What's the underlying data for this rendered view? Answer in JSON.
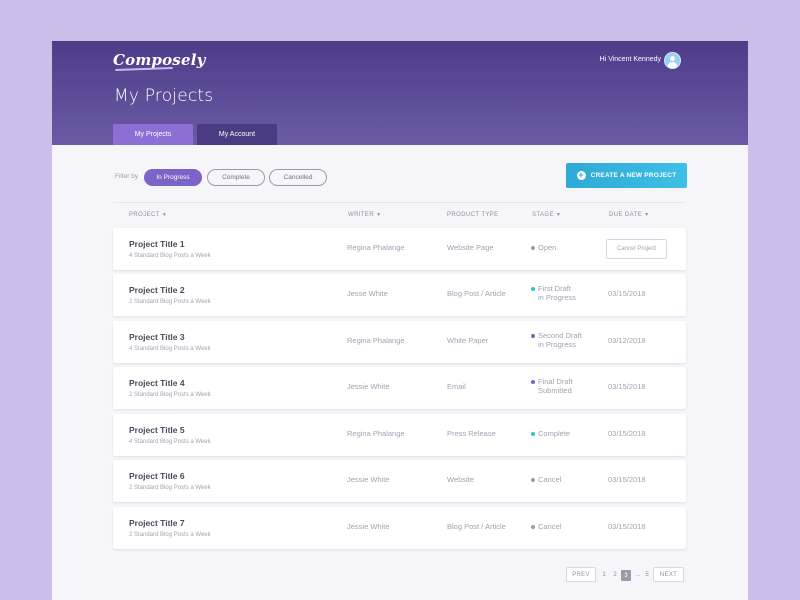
{
  "app": {
    "logo": "Composely",
    "greeting": "Hi Vincent Kennedy",
    "page_title": "My Projects"
  },
  "tabs": [
    {
      "label": "My Projects",
      "active": true
    },
    {
      "label": "My Account",
      "active": false
    }
  ],
  "filter": {
    "label": "Filter by",
    "options": [
      {
        "label": "In Progress",
        "active": true
      },
      {
        "label": "Complete",
        "active": false
      },
      {
        "label": "Cancelled",
        "active": false
      }
    ]
  },
  "create_button": {
    "label": "CREATE A NEW PROJECT",
    "icon": "plus-circle-icon"
  },
  "columns": {
    "project": "PROJECT",
    "writer": "WRITER",
    "product_type": "PRODUCT TYPE",
    "stage": "STAGE",
    "due_date": "DUE DATE"
  },
  "rows": [
    {
      "title": "Project Title 1",
      "subtitle": "4 Standard Blog Posts a Week",
      "writer": "Regina Phalange",
      "product_type": "Website Page",
      "stage": [
        "Open",
        ""
      ],
      "stage_color": "#9a9aab",
      "due_date": "",
      "action": "Cancel Project"
    },
    {
      "title": "Project Title 2",
      "subtitle": "2 Standard Blog Posts a Week",
      "writer": "Jesse White",
      "product_type": "Blog Post / Article",
      "stage": [
        "First Draft",
        "in Progress"
      ],
      "stage_color": "#2fc2d6",
      "due_date": "03/15/2018"
    },
    {
      "title": "Project Title 3",
      "subtitle": "4 Standard Blog Posts a Week",
      "writer": "Regina Phalange",
      "product_type": "White Paper",
      "stage": [
        "Second Draft",
        "in Progress"
      ],
      "stage_color": "#7b63c8",
      "due_date": "03/12/2018"
    },
    {
      "title": "Project Title 4",
      "subtitle": "2 Standard Blog Posts a Week",
      "writer": "Jessie White",
      "product_type": "Email",
      "stage": [
        "Final Draft",
        "Submitted"
      ],
      "stage_color": "#7b63c8",
      "due_date": "03/15/2018"
    },
    {
      "title": "Project Title 5",
      "subtitle": "4 Standard Blog Posts a Week",
      "writer": "Regina Phalange",
      "product_type": "Press Release",
      "stage": [
        "Complete",
        ""
      ],
      "stage_color": "#2fc2d6",
      "due_date": "03/15/2018"
    },
    {
      "title": "Project Title 6",
      "subtitle": "2 Standard Blog Posts a Week",
      "writer": "Jessie White",
      "product_type": "Website",
      "stage": [
        "Cancel",
        ""
      ],
      "stage_color": "#9a9aab",
      "due_date": "03/15/2018"
    },
    {
      "title": "Project Title 7",
      "subtitle": "2 Standard Blog Posts a Week",
      "writer": "Jessie White",
      "product_type": "Blog Post / Article",
      "stage": [
        "Cancel",
        ""
      ],
      "stage_color": "#9a9aab",
      "due_date": "03/15/2018"
    }
  ],
  "pagination": {
    "prev": "PREV",
    "pages": [
      "1",
      "2",
      "3",
      "...",
      "5"
    ],
    "current": "3",
    "next": "NEXT"
  },
  "colors": {
    "background": "#cdbde9",
    "header_top": "#4e3c8a",
    "header_bottom": "#6b5aa3",
    "accent": "#7b63c8",
    "button": "#2fa9d6"
  }
}
